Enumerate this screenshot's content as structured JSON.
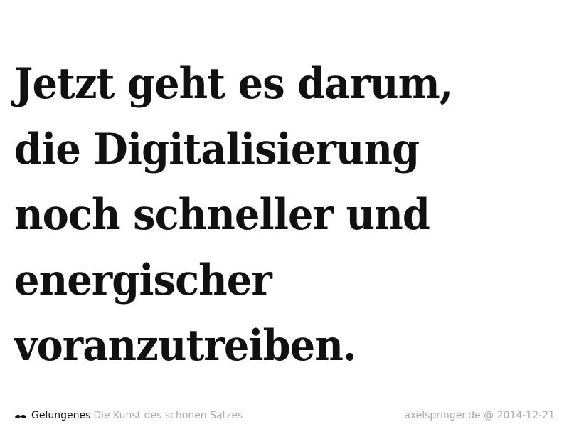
{
  "quote": {
    "lines": [
      "Jetzt geht es darum,",
      "die Digitalisierung",
      "noch schneller und",
      "energischer",
      "voranzutreiben."
    ]
  },
  "footer": {
    "icon": "mustache-icon",
    "brand": "Gelungenes",
    "tagline": "Die Kunst des schönen Satzes",
    "source": "axelspringer.de @ 2014-12-21"
  },
  "colors": {
    "text": "#111111",
    "muted": "#aaaaaa",
    "background": "#ffffff"
  }
}
